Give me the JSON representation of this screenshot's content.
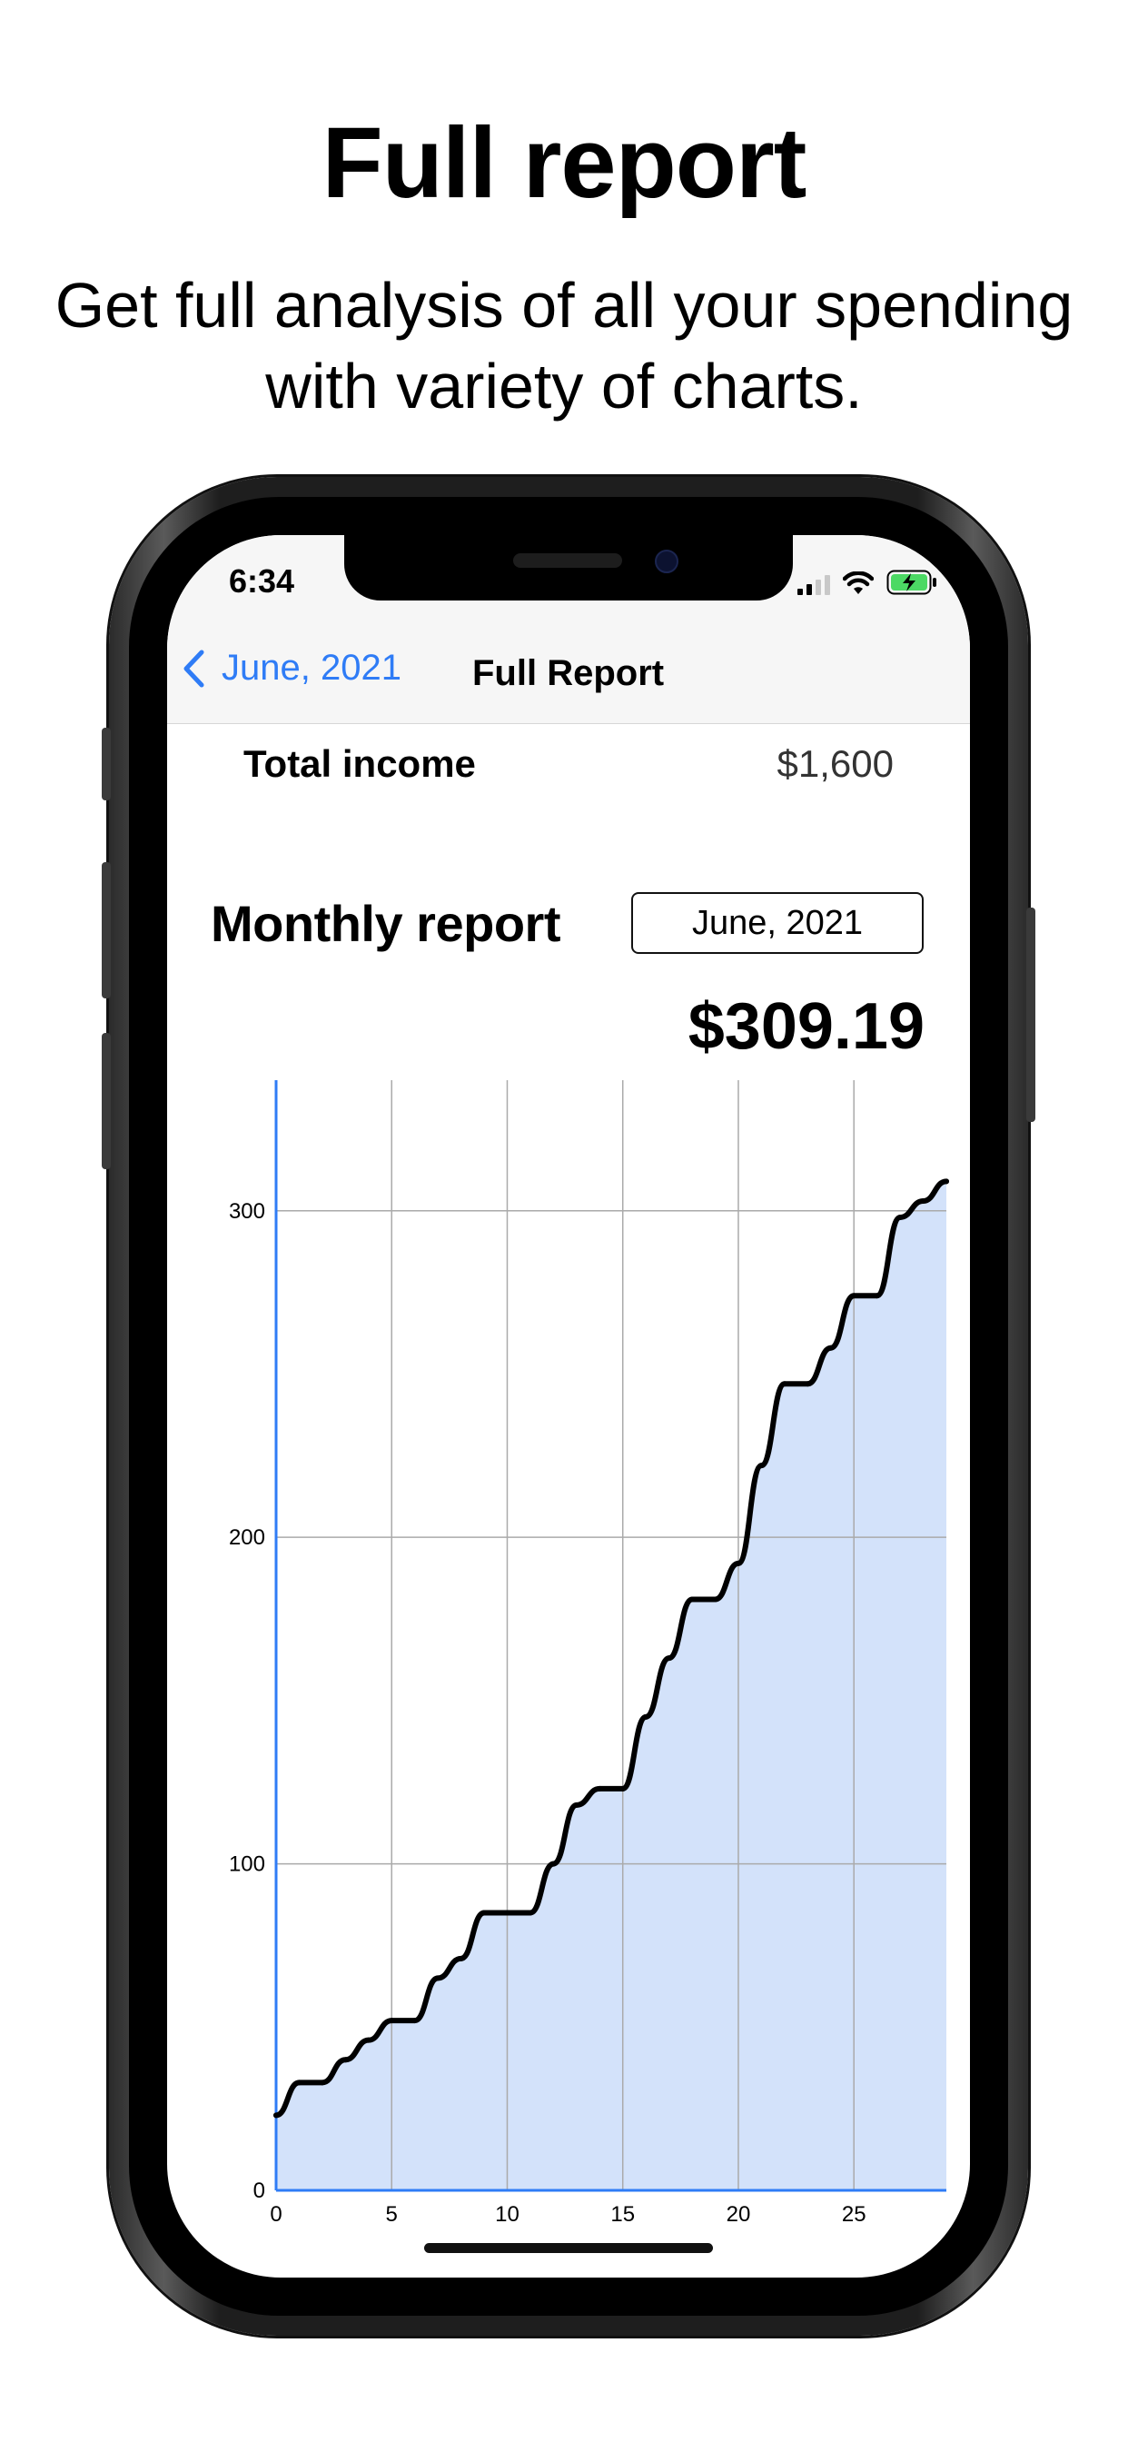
{
  "promo": {
    "title": "Full report",
    "subtitle": "Get full analysis of all your spending with variety of charts."
  },
  "status_bar": {
    "time": "6:34"
  },
  "nav": {
    "back_label": "June, 2021",
    "title": "Full Report"
  },
  "income": {
    "label": "Total income",
    "value": "$1,600"
  },
  "report": {
    "title": "Monthly report",
    "month": "June, 2021",
    "total": "$309.19"
  },
  "colors": {
    "accent": "#2f7cf6",
    "chart_fill": "#d3e2fa",
    "chart_line": "#000000",
    "grid": "#aaaaaa"
  },
  "chart_data": {
    "type": "area",
    "title": "",
    "xlabel": "",
    "ylabel": "",
    "xlim": [
      0,
      29
    ],
    "ylim": [
      0,
      340
    ],
    "x_ticks": [
      0,
      5,
      10,
      15,
      20,
      25
    ],
    "y_ticks": [
      0,
      100,
      200,
      300
    ],
    "grid": true,
    "series": [
      {
        "x": [
          0,
          1,
          2,
          3,
          4,
          5,
          6,
          7,
          8,
          9,
          10,
          11,
          12,
          13,
          14,
          15,
          16,
          17,
          18,
          19,
          20,
          21,
          22,
          23,
          24,
          25,
          26,
          27,
          28,
          29
        ],
        "y": [
          23,
          33,
          33,
          40,
          46,
          52,
          52,
          65,
          71,
          85,
          85,
          85,
          100,
          118,
          123,
          123,
          145,
          163,
          181,
          181,
          192,
          222,
          247,
          247,
          258,
          274,
          274,
          298,
          303,
          309
        ]
      }
    ]
  }
}
